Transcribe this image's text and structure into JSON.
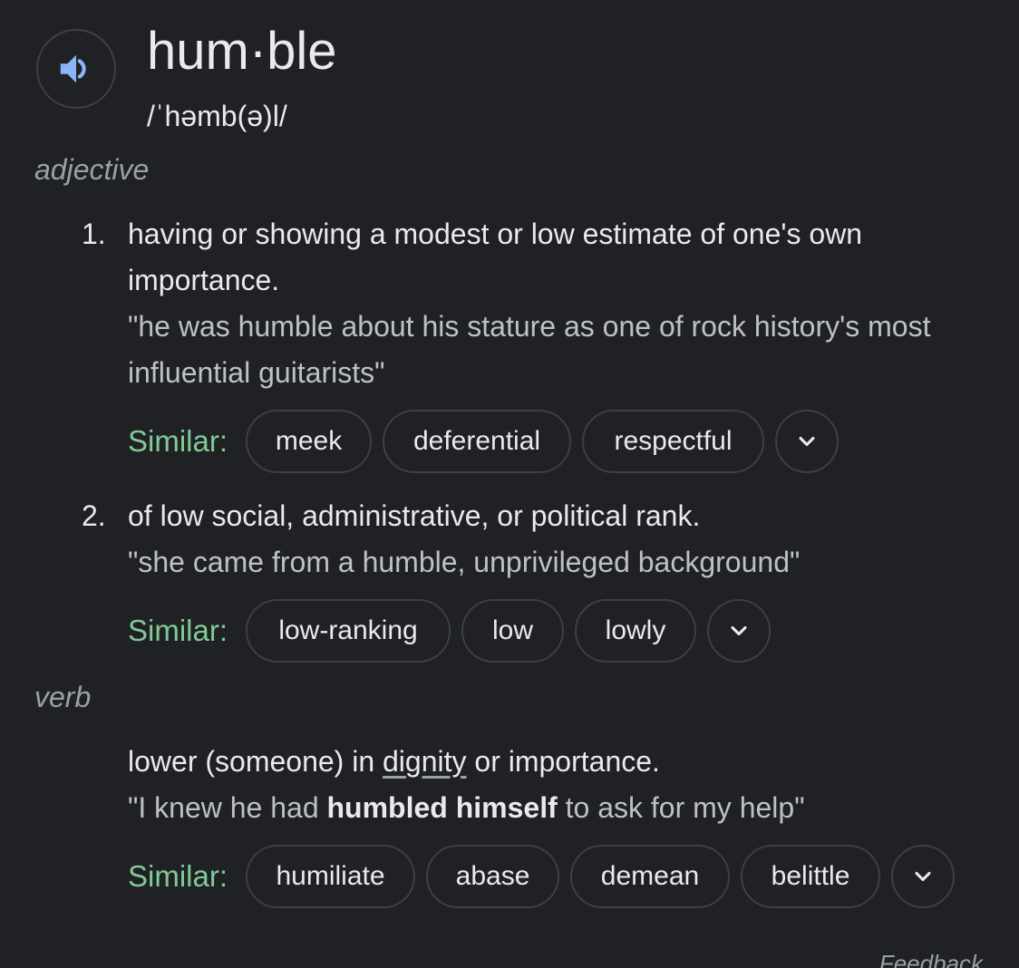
{
  "entry": {
    "headword": "hum·ble",
    "phonetic": "/ˈhəmb(ə)l/",
    "speaker_icon": "speaker-icon"
  },
  "adjective": {
    "label": "adjective",
    "senses": [
      {
        "number": "1.",
        "definition": "having or showing a modest or low estimate of one's own importance.",
        "example": "\"he was humble about his stature as one of rock history's most influential guitarists\"",
        "similar_label": "Similar:",
        "similar": [
          "meek",
          "deferential",
          "respectful"
        ]
      },
      {
        "number": "2.",
        "definition": "of low social, administrative, or political rank.",
        "example": "\"she came from a humble, unprivileged background\"",
        "similar_label": "Similar:",
        "similar": [
          "low-ranking",
          "low",
          "lowly"
        ]
      }
    ]
  },
  "verb": {
    "label": "verb",
    "sense": {
      "definition_before": "lower (someone) in ",
      "definition_link": "dignity",
      "definition_after": " or importance.",
      "example_before": "\"I knew he had ",
      "example_bold": "humbled himself",
      "example_after": " to ask for my help\"",
      "similar_label": "Similar:",
      "similar": [
        "humiliate",
        "abase",
        "demean",
        "belittle"
      ]
    }
  },
  "footer": {
    "feedback": "Feedback"
  },
  "colors": {
    "background": "#202124",
    "text": "#e8eaed",
    "muted": "#9aa0a6",
    "similar_label": "#81c995",
    "chip_border": "#3c4043",
    "speaker": "#8ab4f8"
  }
}
